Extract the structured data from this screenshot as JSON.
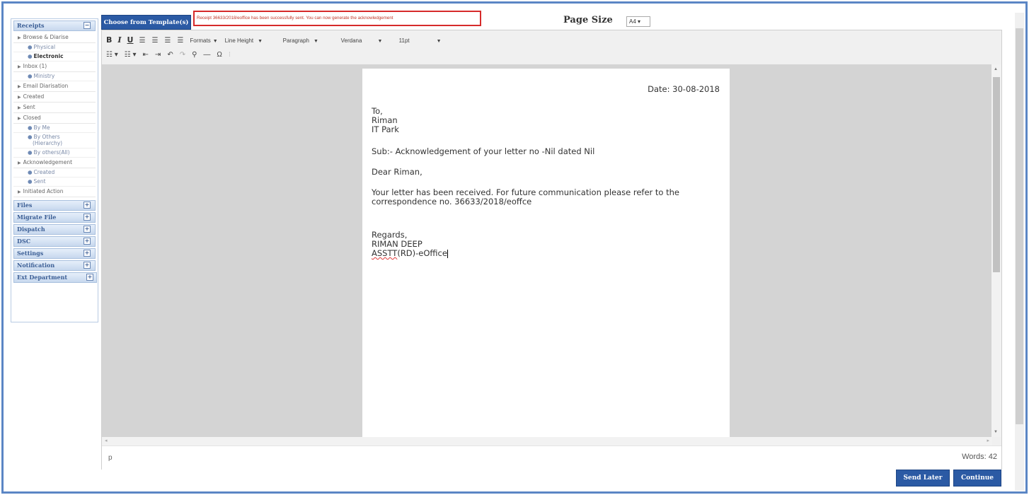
{
  "sidebar": {
    "receipts": {
      "title": "Receipts",
      "toggle": "−",
      "items": {
        "browse": "Browse & Diarise",
        "physical": "Physical",
        "electronic": "Electronic",
        "inbox": "Inbox (1)",
        "ministry": "Ministry",
        "email": "Email Diarisation",
        "created": "Created",
        "sent": "Sent",
        "closed": "Closed",
        "by_me": "By Me",
        "by_others_1": "By Others",
        "by_others_2": "(Hierarchy)",
        "by_others_all": "By others(All)",
        "ack": "Acknowledgement",
        "ack_created": "Created",
        "ack_sent": "Sent",
        "initiated": "Initiated Action"
      }
    },
    "sections": [
      {
        "title": "Files",
        "toggle": "+"
      },
      {
        "title": "Migrate File",
        "toggle": "+"
      },
      {
        "title": "Dispatch",
        "toggle": "+"
      },
      {
        "title": "DSC",
        "toggle": "+"
      },
      {
        "title": "Settings",
        "toggle": "+"
      },
      {
        "title": "Notification",
        "toggle": "+"
      },
      {
        "title": "Ext Department",
        "toggle": "+"
      }
    ]
  },
  "top": {
    "template_button": "Choose from Template(s)",
    "notice": "Receipt 36633/2018/eoffice has been successfully sent. You can now generate the acknowledgement",
    "page_size_label": "Page Size",
    "page_size_value": "A4 ▾"
  },
  "toolbar": {
    "bold": "B",
    "italic": "I",
    "underline": "U",
    "formats": "Formats",
    "line_height": "Line Height",
    "paragraph": "Paragraph",
    "font": "Verdana",
    "size": "11pt"
  },
  "letter": {
    "date": "Date: 30-08-2018",
    "to": "To,",
    "name": "Riman",
    "address": "IT Park",
    "subject": "Sub:- Acknowledgement of your letter no -Nil dated Nil",
    "salutation": "Dear Riman,",
    "body_1": "Your letter has been received. For future communication please refer to the",
    "body_2": "correspondence no. 36633/2018/eoffce",
    "regards": "Regards,",
    "sender": "RIMAN DEEP",
    "designation_a": "ASSTT",
    "designation_b": "(RD)-eOffice"
  },
  "status": {
    "path": "p",
    "words": "Words: 42"
  },
  "buttons": {
    "send_later": "Send Later",
    "continue": "Continue"
  }
}
